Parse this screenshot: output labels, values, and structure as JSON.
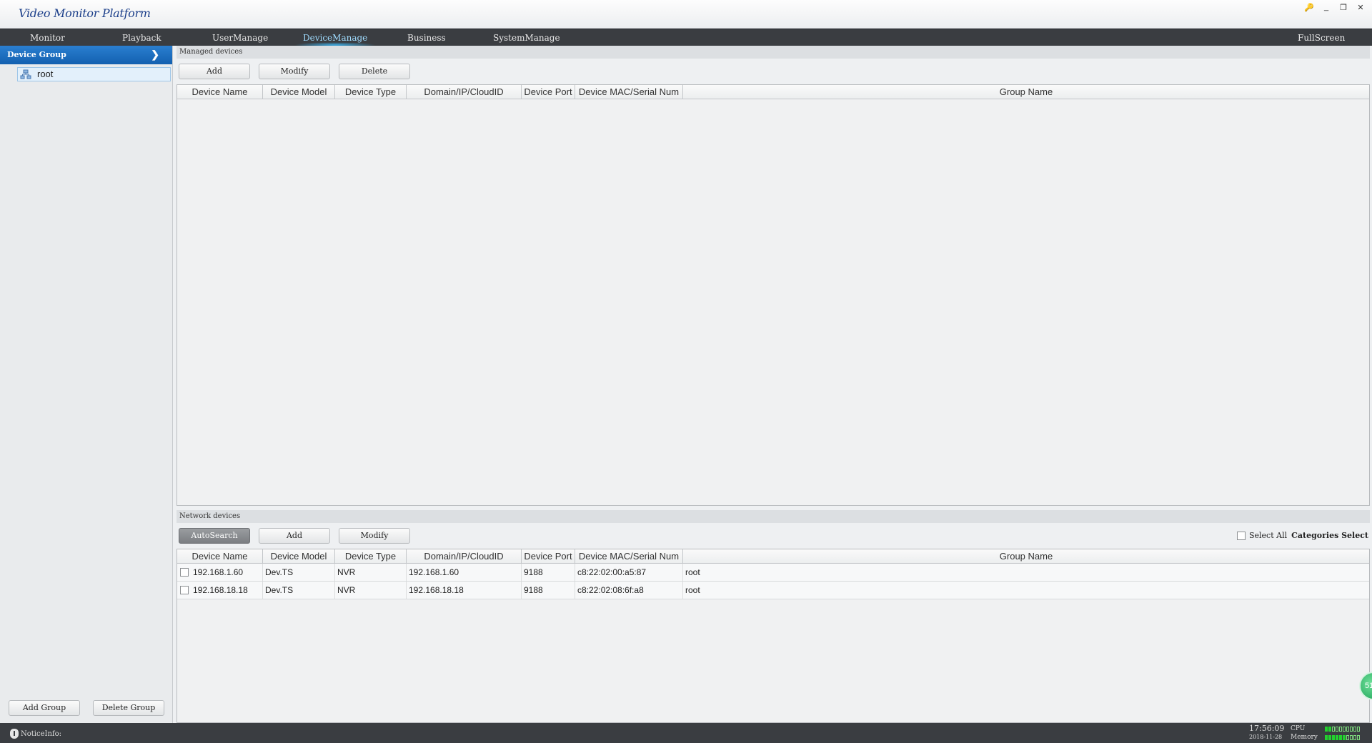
{
  "window": {
    "title": "Video Monitor Platform",
    "controls": [
      "pin-icon",
      "minimize-icon",
      "restore-icon",
      "close-icon"
    ]
  },
  "menu": {
    "items": [
      "Monitor",
      "Playback",
      "UserManage",
      "DeviceManage",
      "Business",
      "SystemManage"
    ],
    "active": "DeviceManage",
    "fullscreen": "FullScreen"
  },
  "sidebar": {
    "header": "Device Group",
    "tree_root": "root",
    "add_group": "Add Group",
    "delete_group": "Delete Group"
  },
  "managed": {
    "title": "Managed devices",
    "buttons": {
      "add": "Add",
      "modify": "Modify",
      "delete": "Delete"
    },
    "columns": [
      "Device Name",
      "Device Model",
      "Device Type",
      "Domain/IP/CloudID",
      "Device Port",
      "Device MAC/Serial Num",
      "Group Name"
    ],
    "rows": []
  },
  "network": {
    "title": "Network devices",
    "buttons": {
      "autosearch": "AutoSearch",
      "add": "Add",
      "modify": "Modify"
    },
    "select_all": "Select All",
    "categories": "Categories Select",
    "columns": [
      "Device Name",
      "Device Model",
      "Device Type",
      "Domain/IP/CloudID",
      "Device Port",
      "Device MAC/Serial Num",
      "Group Name"
    ],
    "rows": [
      [
        "192.168.1.60",
        "Dev.TS",
        "NVR",
        "192.168.1.60",
        "9188",
        "c8:22:02:00:a5:87",
        "root"
      ],
      [
        "192.168.18.18",
        "Dev.TS",
        "NVR",
        "192.168.18.18",
        "9188",
        "c8:22:02:08:6f:a8",
        "root"
      ]
    ]
  },
  "status": {
    "notice": "NoticeInfo:",
    "time": "17:56:09",
    "date": "2018-11-28",
    "cpu_label": "CPU",
    "memory_label": "Memory",
    "cpu_level": 0.2,
    "memory_level": 0.6,
    "badge": "51"
  },
  "colors": {
    "menubar": "#3a3d41",
    "sidebar_header": "#1a6cc0",
    "active_menu": "#9fdcff",
    "meter": "#22d12e"
  }
}
